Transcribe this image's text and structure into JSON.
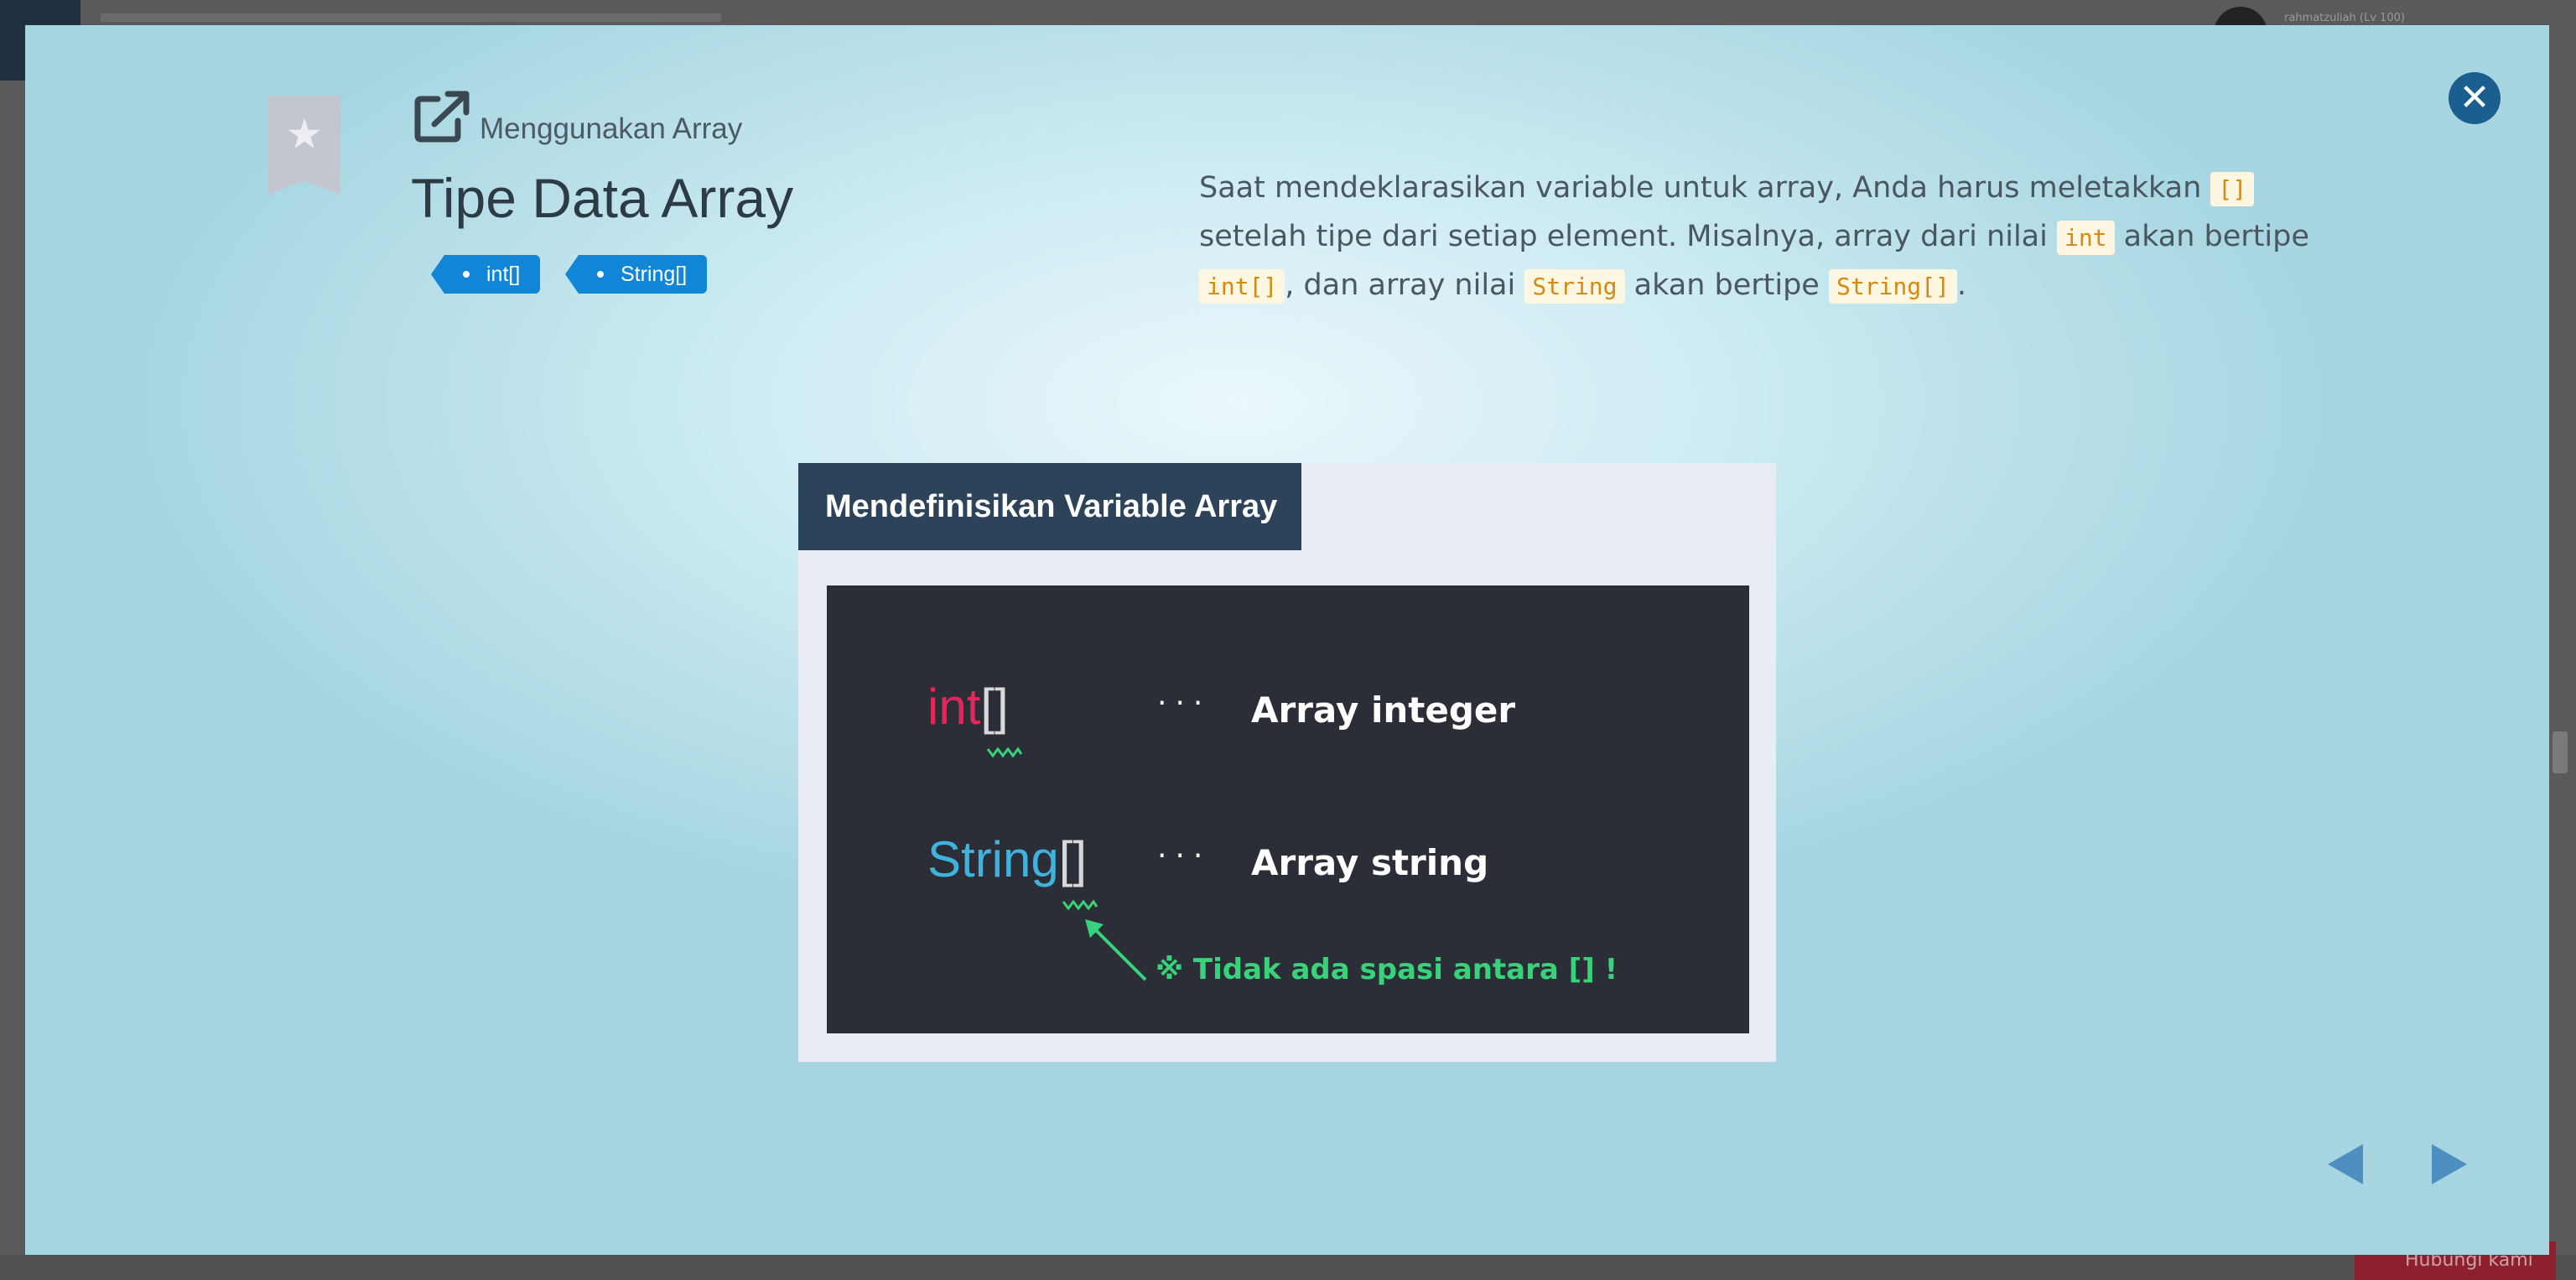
{
  "background": {
    "user_label": "rahmatzuliah (Lv 100)",
    "bottom_button_label": "Hubungi kami"
  },
  "header": {
    "breadcrumb": "Menggunakan Array",
    "title": "Tipe Data Array",
    "tags": [
      "int[]",
      "String[]"
    ]
  },
  "description": {
    "part1": "Saat mendeklarasikan variable untuk array, Anda harus meletakkan ",
    "code1": "[]",
    "part2": " setelah tipe dari setiap element. Misalnya, array dari nilai ",
    "code2": "int",
    "part3": " akan bertipe ",
    "code3": "int[]",
    "part4": ", dan array nilai ",
    "code4": "String",
    "part5": " akan bertipe ",
    "code5": "String[]",
    "part6": "."
  },
  "figure": {
    "title": "Mendefinisikan Variable Array",
    "rows": [
      {
        "type": "int",
        "brackets": "[]",
        "dots": "···",
        "meaning": "Array integer"
      },
      {
        "type": "String",
        "brackets": "[]",
        "dots": "···",
        "meaning": "Array string"
      }
    ],
    "note": "※ Tidak ada spasi antara [] !"
  },
  "icons": {
    "bookmark": "bookmark-star-icon",
    "external": "external-link-icon",
    "close": "close-icon",
    "prev": "arrow-left-icon",
    "next": "arrow-right-icon"
  },
  "colors": {
    "tag": "#1185d6",
    "close": "#1a5f8e",
    "nav": "#4d8fc0",
    "code_highlight": "#d38a14",
    "int_keyword": "#e0285a",
    "string_keyword": "#3fb3dd",
    "note": "#38d27a"
  }
}
